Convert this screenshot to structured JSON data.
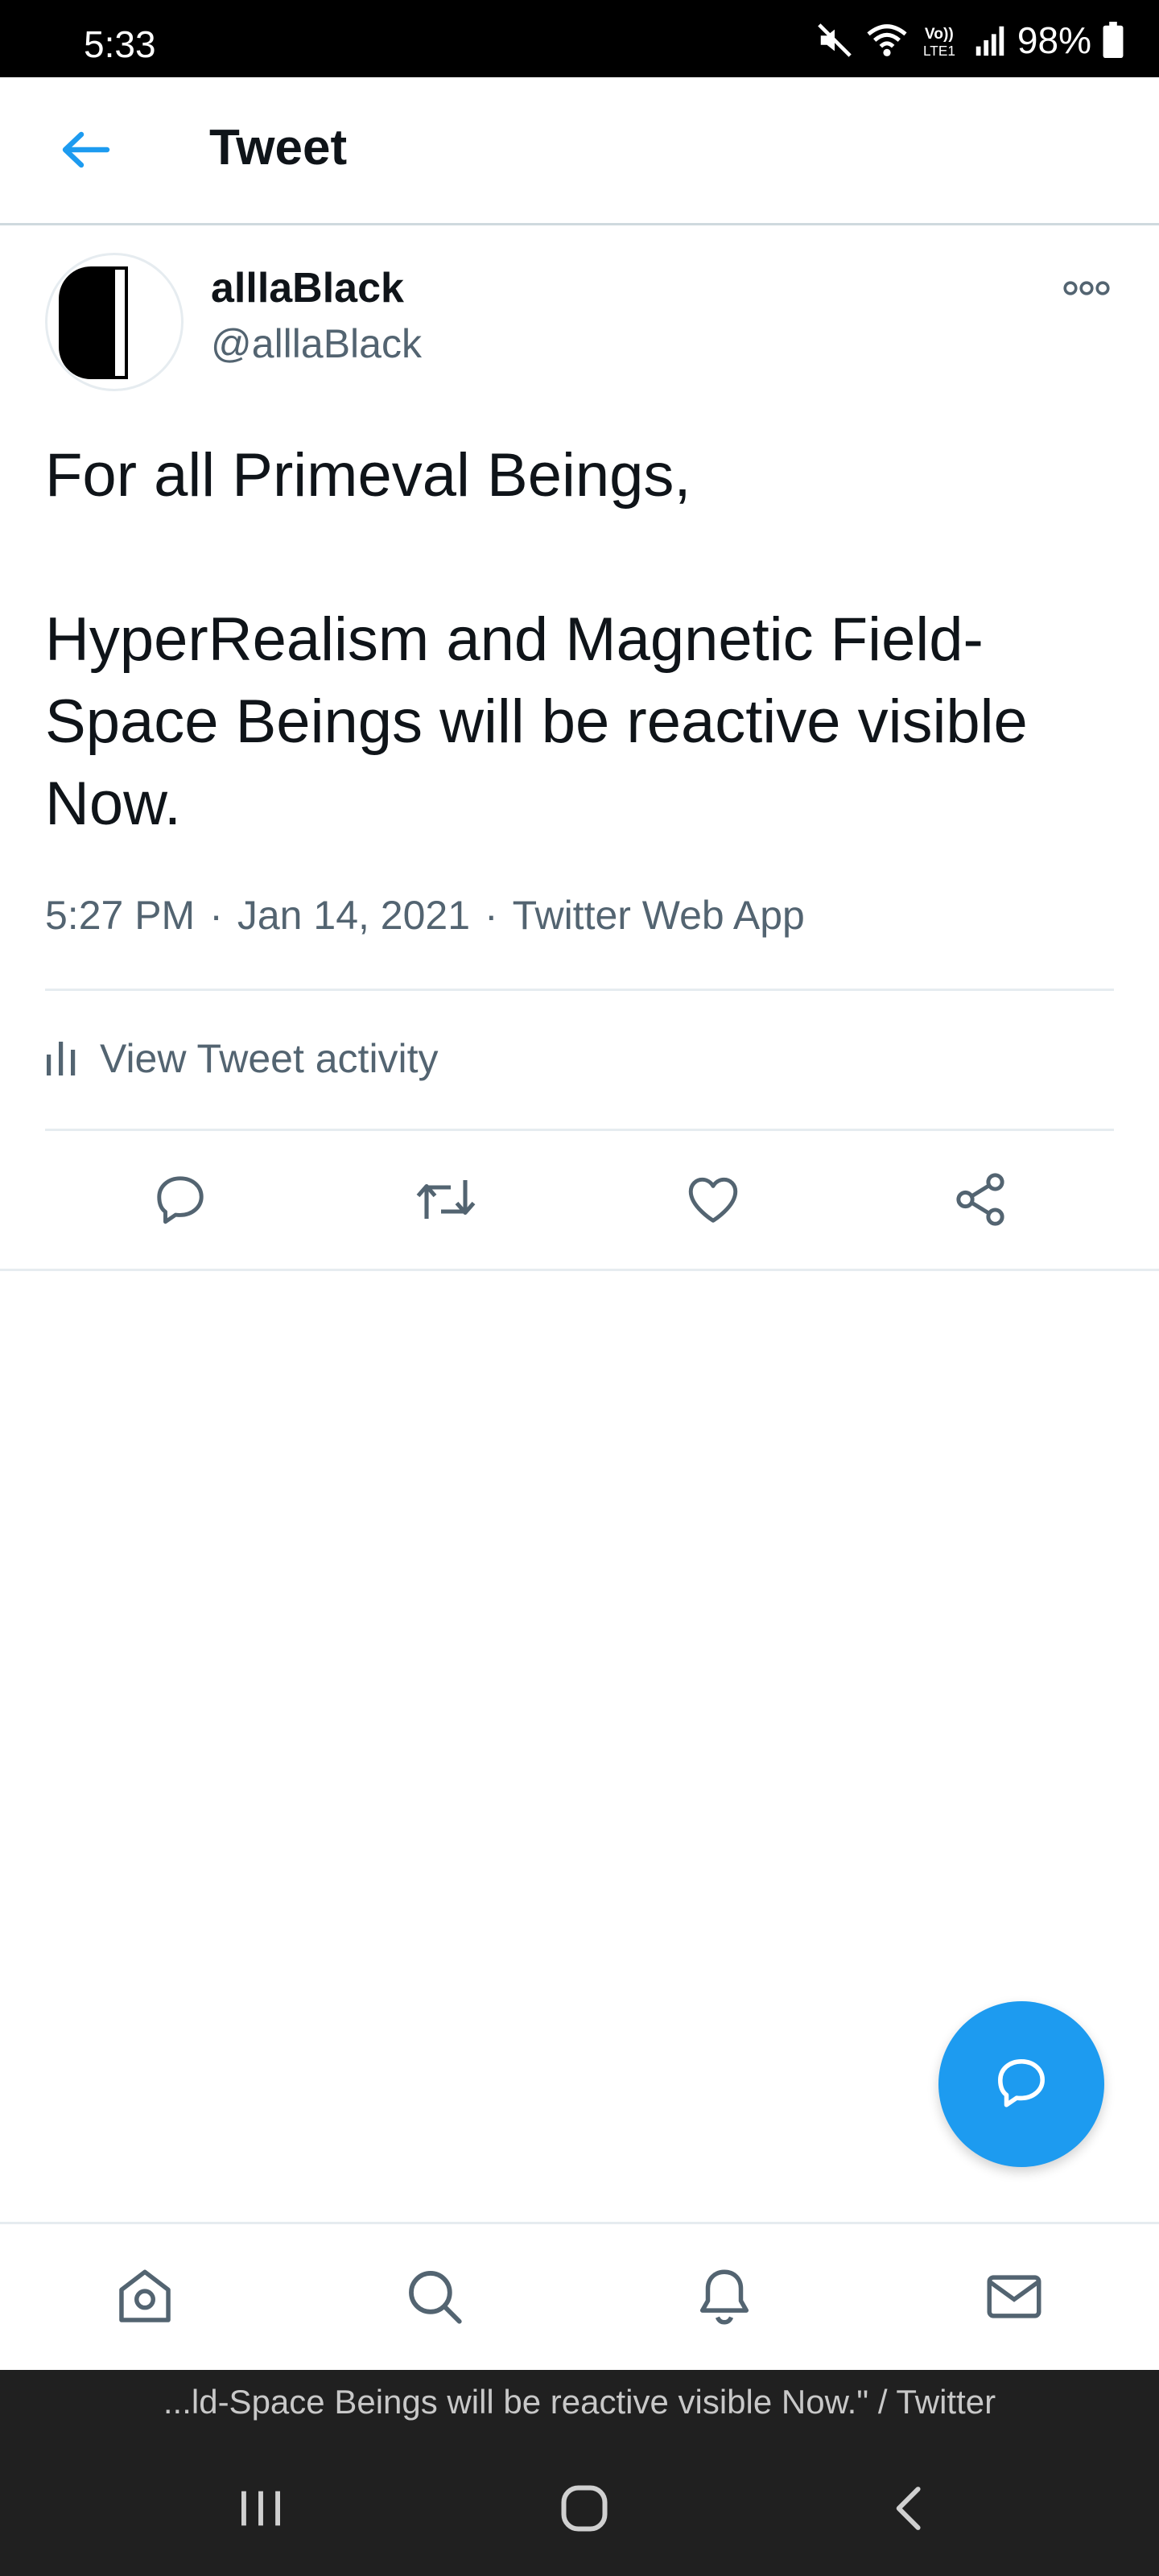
{
  "status_bar": {
    "time": "5:33",
    "battery": "98%",
    "icons": [
      "mute-icon",
      "wifi-icon",
      "volte-icon",
      "signal-icon",
      "battery-icon"
    ]
  },
  "header": {
    "title": "Tweet",
    "back_icon": "arrow-left-icon"
  },
  "tweet": {
    "display_name": "alllaBlack",
    "handle": "@alllaBlack",
    "body": [
      "For all Primeval Beings,",
      "",
      "HyperRealism and Magnetic Field-Space Beings will be reactive visible Now."
    ],
    "time": "5:27 PM",
    "date": "Jan 14, 2021",
    "source": "Twitter Web App",
    "separator": "·"
  },
  "activity": {
    "label": "View Tweet activity"
  },
  "actions": [
    "reply-icon",
    "retweet-icon",
    "like-icon",
    "share-icon"
  ],
  "bottom_nav": [
    "home-icon",
    "search-icon",
    "notifications-icon",
    "messages-icon"
  ],
  "browser_title": "...ld-Space Beings will be reactive visible Now.\" / Twitter",
  "colors": {
    "accent": "#1d9bf0",
    "secondary_text": "#536471",
    "divider": "#e6ecf0"
  }
}
